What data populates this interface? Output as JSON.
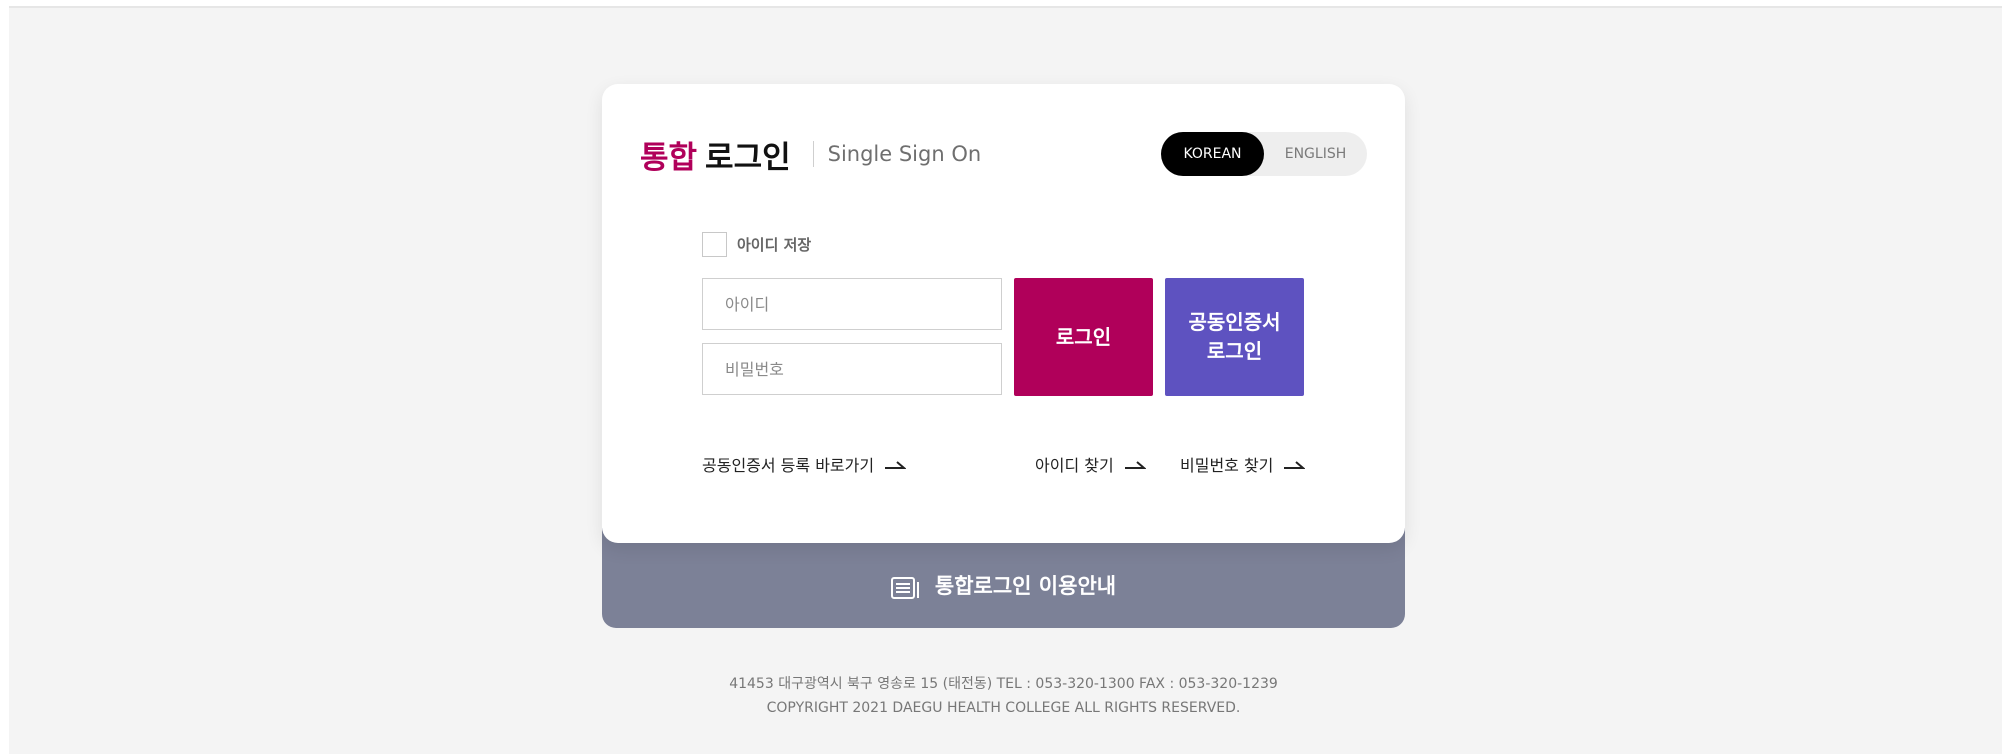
{
  "header": {
    "title_highlight": "통합",
    "title_main": "로그인",
    "subtitle": "Single Sign On"
  },
  "language": {
    "korean": "KOREAN",
    "english": "ENGLISH",
    "selected": "KOREAN"
  },
  "form": {
    "remember_label": "아이디 저장",
    "id_placeholder": "아이디",
    "pw_placeholder": "비밀번호",
    "login_button": "로그인",
    "cert_login_button": "공동인증서\n로그인"
  },
  "links": {
    "cert_register": "공동인증서 등록 바로가기",
    "find_id": "아이디 찾기",
    "find_pw": "비밀번호 찾기"
  },
  "guide": {
    "label": "통합로그인 이용안내",
    "icon": "document-list-icon"
  },
  "footer": {
    "address": "41453 대구광역시 북구 영송로 15 (태전동)  TEL : 053-320-1300  FAX : 053-320-1239",
    "copyright": "COPYRIGHT 2021 DAEGU HEALTH COLLEGE ALL RIGHTS RESERVED."
  },
  "colors": {
    "brand": "#b0005a",
    "cert": "#5e52c0",
    "guide_bar": "#7c8197",
    "lang_active": "#000000"
  }
}
